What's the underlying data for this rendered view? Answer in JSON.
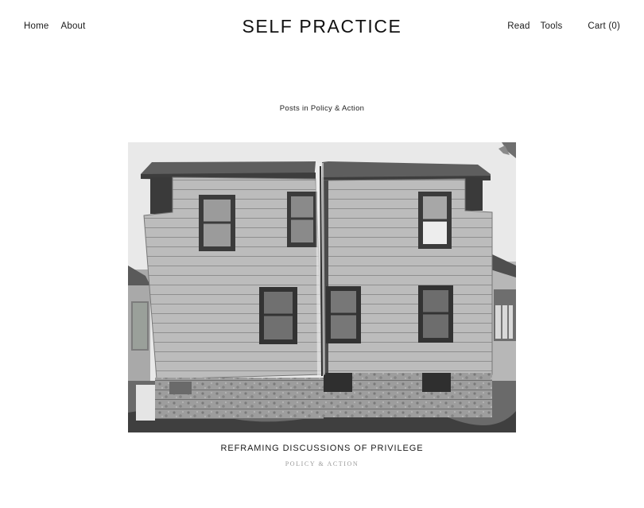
{
  "nav": {
    "home": "Home",
    "about": "About",
    "read": "Read",
    "tools": "Tools",
    "cart": "Cart (0)"
  },
  "site": {
    "title": "SELF PRACTICE"
  },
  "archive": {
    "heading": "Posts in Policy & Action"
  },
  "post": {
    "title": "REFRAMING DISCUSSIONS OF PRIVILEGE",
    "category": "POLICY & ACTION",
    "image_description": "black-and-white photograph of a house split in two"
  },
  "colors": {
    "text": "#1a1a1a",
    "muted": "#9a9a9a",
    "background": "#ffffff"
  }
}
